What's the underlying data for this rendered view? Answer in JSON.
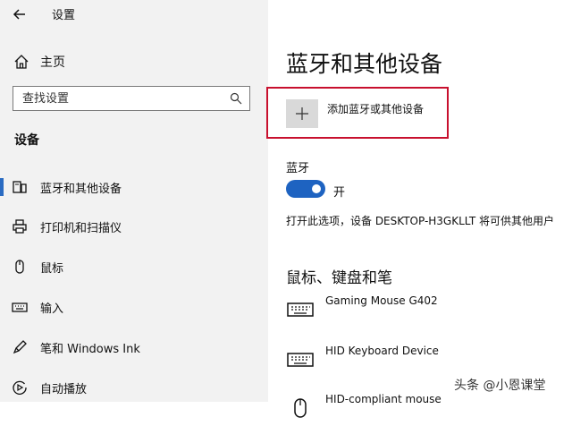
{
  "window": {
    "title": "设置"
  },
  "sidebar": {
    "home_label": "主页",
    "search_placeholder": "查找设置",
    "section_label": "设备",
    "items": [
      {
        "label": "蓝牙和其他设备",
        "icon": "bluetooth-devices-icon",
        "active": true
      },
      {
        "label": "打印机和扫描仪",
        "icon": "printer-icon",
        "active": false
      },
      {
        "label": "鼠标",
        "icon": "mouse-icon",
        "active": false
      },
      {
        "label": "输入",
        "icon": "keyboard-icon",
        "active": false
      },
      {
        "label": "笔和 Windows Ink",
        "icon": "pen-icon",
        "active": false
      },
      {
        "label": "自动播放",
        "icon": "autoplay-icon",
        "active": false
      }
    ]
  },
  "main": {
    "title": "蓝牙和其他设备",
    "add_device_label": "添加蓝牙或其他设备",
    "bluetooth_label": "蓝牙",
    "toggle": {
      "state_label": "开",
      "on": true
    },
    "discover_text": "打开此选项，设备 DESKTOP-H3GKLLT 将可供其他用户",
    "devices_heading": "鼠标、键盘和笔",
    "devices": [
      {
        "name": "Gaming Mouse G402",
        "icon": "keyboard-device-icon"
      },
      {
        "name": "HID Keyboard Device",
        "icon": "keyboard-device-icon"
      },
      {
        "name": "HID-compliant mouse",
        "icon": "mouse-device-icon"
      }
    ]
  },
  "watermark": {
    "text": "头条 @小恩课堂"
  },
  "colors": {
    "accent": "#1e63c1",
    "highlight_border": "#c8102e",
    "sidebar_bg": "#f2f2f2"
  }
}
